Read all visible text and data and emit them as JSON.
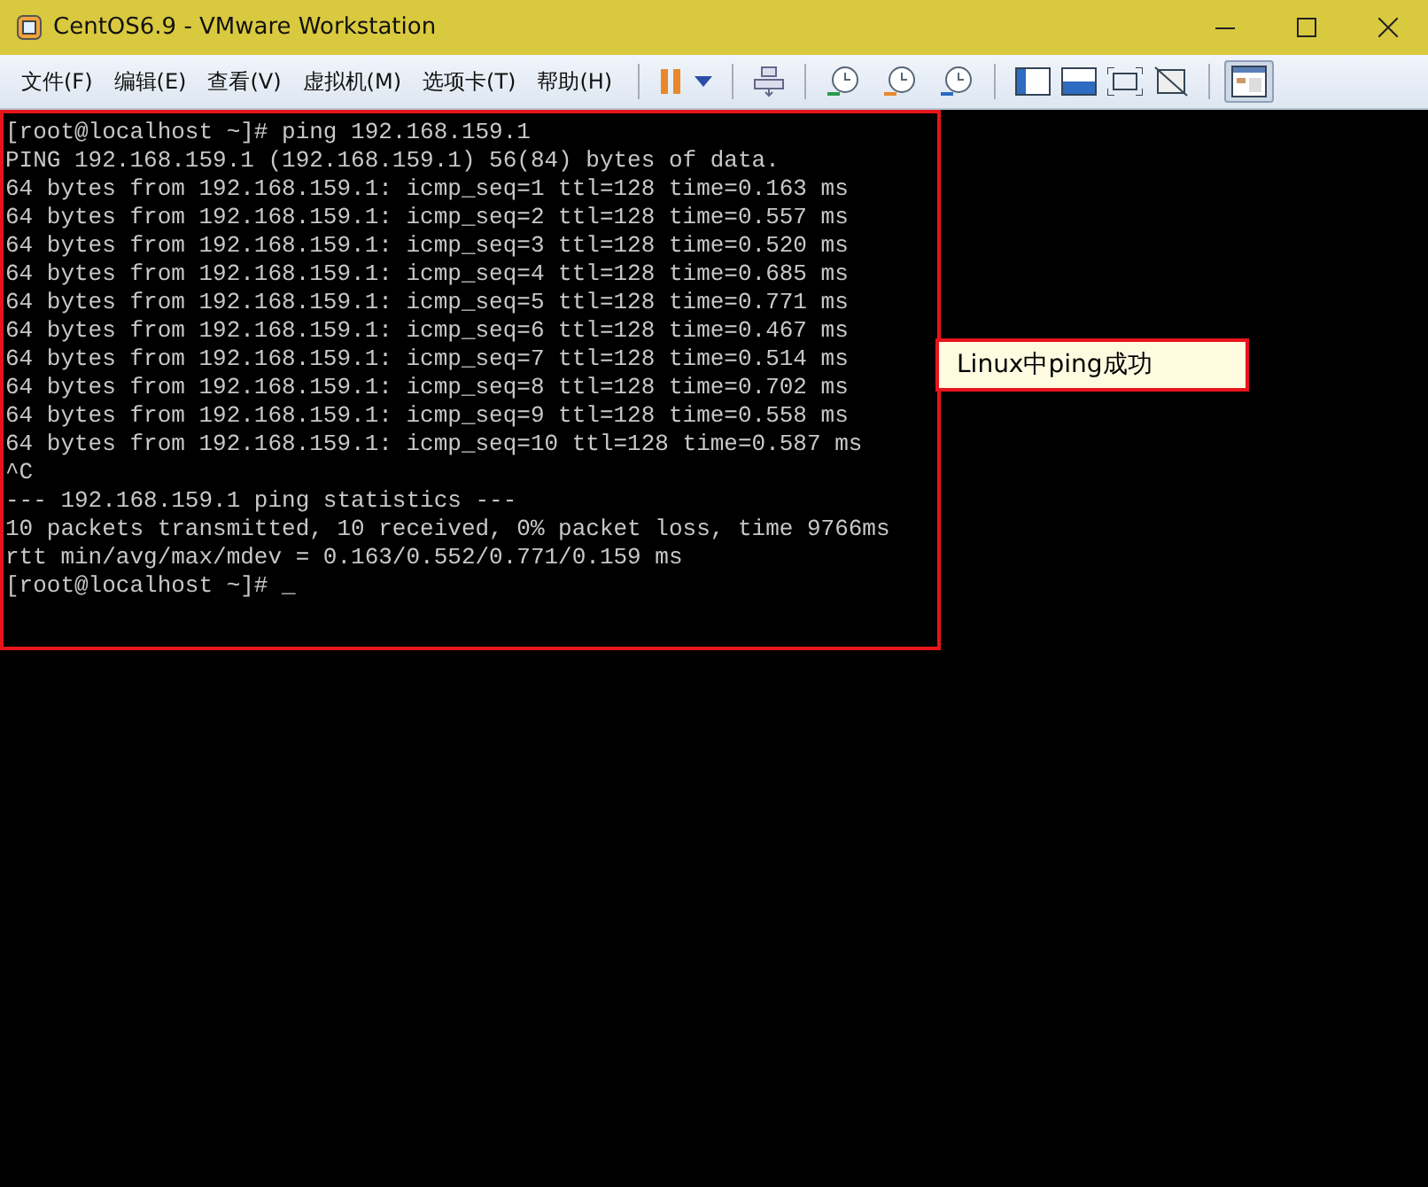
{
  "window": {
    "title": "CentOS6.9 - VMware Workstation"
  },
  "menu": [
    {
      "label": "文件(F)"
    },
    {
      "label": "编辑(E)"
    },
    {
      "label": "查看(V)"
    },
    {
      "label": "虚拟机(M)"
    },
    {
      "label": "选项卡(T)"
    },
    {
      "label": "帮助(H)"
    }
  ],
  "terminal": {
    "lines": [
      "[root@localhost ~]# ping 192.168.159.1",
      "PING 192.168.159.1 (192.168.159.1) 56(84) bytes of data.",
      "64 bytes from 192.168.159.1: icmp_seq=1 ttl=128 time=0.163 ms",
      "64 bytes from 192.168.159.1: icmp_seq=2 ttl=128 time=0.557 ms",
      "64 bytes from 192.168.159.1: icmp_seq=3 ttl=128 time=0.520 ms",
      "64 bytes from 192.168.159.1: icmp_seq=4 ttl=128 time=0.685 ms",
      "64 bytes from 192.168.159.1: icmp_seq=5 ttl=128 time=0.771 ms",
      "64 bytes from 192.168.159.1: icmp_seq=6 ttl=128 time=0.467 ms",
      "64 bytes from 192.168.159.1: icmp_seq=7 ttl=128 time=0.514 ms",
      "64 bytes from 192.168.159.1: icmp_seq=8 ttl=128 time=0.702 ms",
      "64 bytes from 192.168.159.1: icmp_seq=9 ttl=128 time=0.558 ms",
      "64 bytes from 192.168.159.1: icmp_seq=10 ttl=128 time=0.587 ms",
      "^C",
      "--- 192.168.159.1 ping statistics ---",
      "10 packets transmitted, 10 received, 0% packet loss, time 9766ms",
      "rtt min/avg/max/mdev = 0.163/0.552/0.771/0.159 ms",
      "[root@localhost ~]# _"
    ]
  },
  "callout": {
    "text": "Linux中ping成功"
  }
}
